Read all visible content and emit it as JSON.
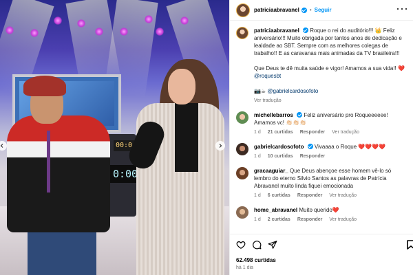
{
  "post": {
    "username": "patriciaabravanel",
    "follow_label": "Seguir",
    "separator": "•"
  },
  "caption": {
    "username": "patriciaabravanel",
    "line1": "Roque o rei do auditório!!! 👑 Feliz aniversário!!! Muito obrigada por tantos anos de dedicação e lealdade ao SBT. Sempre com as melhores colegas de trabalho!! E as caravanas mais animadas da TV brasileira!!!",
    "line2": "Que Deus te dê muita saúde e vigor! Amamos a sua vida!! ❤️",
    "mention1": "@roquesbt",
    "line3_prefix": "📷☕",
    "mention2": "@gabrielcardosofoto",
    "translate": "Ver tradução"
  },
  "comments": [
    {
      "username": "michellebarros",
      "verified": true,
      "text": "Feliz aniversário pro Roqueeeeee! Amamos vc! 👏🏻👏🏻👏🏻",
      "time": "1 d",
      "likes": "21 curtidas",
      "reply": "Responder",
      "translate": "Ver tradução"
    },
    {
      "username": "gabrielcardosofoto",
      "verified": true,
      "text": "Vivaaaa o Roque ❤️❤️❤️❤️",
      "time": "1 d",
      "likes": "10 curtidas",
      "reply": "Responder",
      "translate": ""
    },
    {
      "username": "gracaaguiar_",
      "verified": false,
      "text": "Que Deus abençoe esse homem vê-lo só lembro do eterno Silvio Santos as palavras de Patrícia Abravanel muito linda fiquei emocionada",
      "time": "1 d",
      "likes": "6 curtidas",
      "reply": "Responder",
      "translate": "Ver tradução"
    },
    {
      "username": "home_abravanel",
      "verified": false,
      "text": "Muito querido❤️",
      "time": "1 d",
      "likes": "2 curtidas",
      "reply": "Responder",
      "translate": "Ver tradução"
    }
  ],
  "footer": {
    "likes": "62.498 curtidas",
    "time": "há 1 dia"
  },
  "media": {
    "clock_big": "0:00",
    "clock_small": "00:0"
  },
  "icons": {
    "like": "heart-icon",
    "comment": "comment-icon",
    "share": "share-icon",
    "save": "bookmark-icon"
  }
}
